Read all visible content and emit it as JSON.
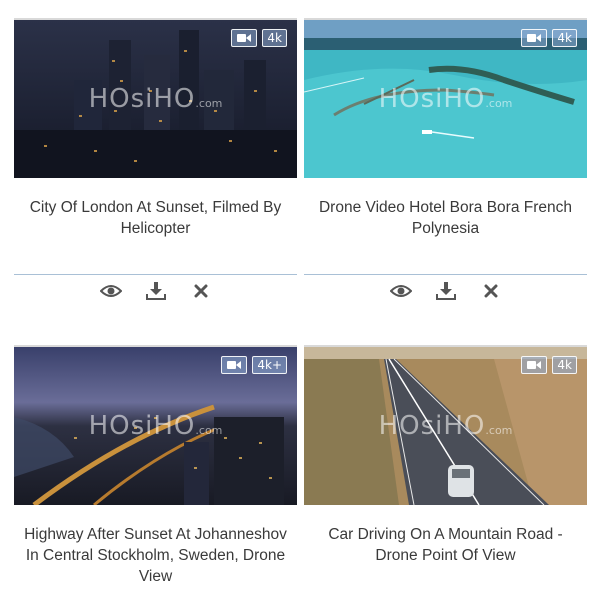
{
  "watermark": {
    "brand": "HOsiHO",
    "suffix": ".com"
  },
  "cards": [
    {
      "title": "City Of London At Sunset, Filmed By Helicopter",
      "res": "4k"
    },
    {
      "title": "Drone Video Hotel Bora Bora French Polynesia",
      "res": "4k"
    },
    {
      "title": "Highway After Sunset At Johanneshov In Central Stockholm, Sweden, Drone View",
      "res": "4k+"
    },
    {
      "title": "Car Driving On A Mountain Road - Drone Point Of View",
      "res": "4k"
    }
  ],
  "actions": [
    {
      "icon": "eye-icon"
    },
    {
      "icon": "download-icon"
    },
    {
      "icon": "close-icon"
    }
  ],
  "colors": {
    "separator": "#a9c0d6",
    "icon": "#555555",
    "title_text": "#3a3a3a"
  }
}
